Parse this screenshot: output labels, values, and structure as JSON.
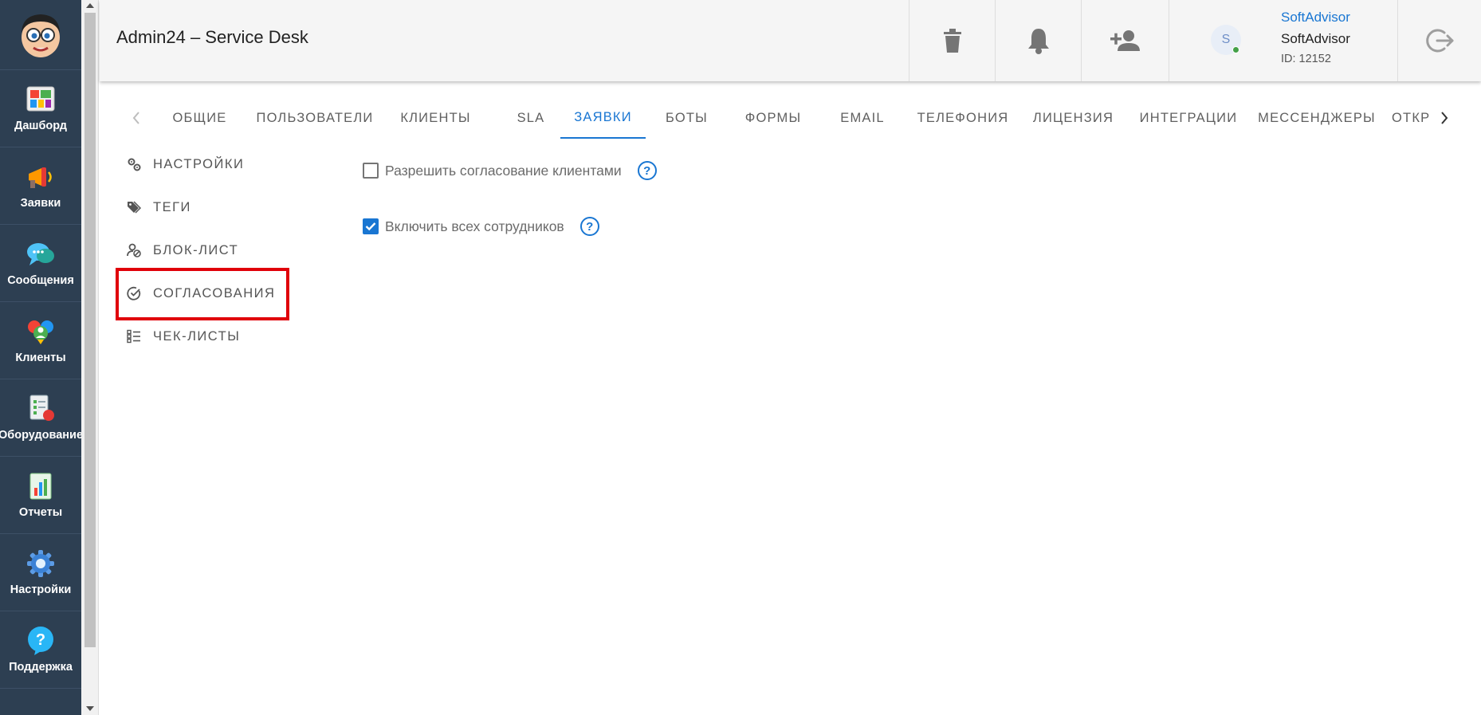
{
  "sidebar": {
    "items": [
      {
        "label": "Дашборд",
        "icon": "dashboard-icon"
      },
      {
        "label": "Заявки",
        "icon": "megaphone-icon"
      },
      {
        "label": "Сообщения",
        "icon": "chat-bubbles-icon"
      },
      {
        "label": "Клиенты",
        "icon": "clients-icon"
      },
      {
        "label": "Оборудование",
        "icon": "equipment-icon"
      },
      {
        "label": "Отчеты",
        "icon": "reports-icon"
      },
      {
        "label": "Настройки",
        "icon": "gear-icon"
      },
      {
        "label": "Поддержка",
        "icon": "support-icon"
      }
    ]
  },
  "header": {
    "title": "Admin24 – Service Desk",
    "user": {
      "avatar_letter": "S",
      "link_name": "SoftAdvisor",
      "name": "SoftAdvisor",
      "id_text": "ID: 12152"
    }
  },
  "tabs": {
    "items": [
      "ОБЩИЕ",
      "ПОЛЬЗОВАТЕЛИ",
      "КЛИЕНТЫ",
      "SLA",
      "ЗАЯВКИ",
      "БОТЫ",
      "ФОРМЫ",
      "EMAIL",
      "ТЕЛЕФОНИЯ",
      "ЛИЦЕНЗИЯ",
      "ИНТЕГРАЦИИ",
      "МЕССЕНДЖЕРЫ",
      "ОТКР"
    ],
    "active": "ЗАЯВКИ"
  },
  "side_menu": {
    "items": [
      {
        "label": "НАСТРОЙКИ",
        "icon": "settings-cog-icon"
      },
      {
        "label": "ТЕГИ",
        "icon": "tags-icon"
      },
      {
        "label": "БЛОК-ЛИСТ",
        "icon": "block-list-icon"
      },
      {
        "label": "СОГЛАСОВАНИЯ",
        "icon": "check-circle-icon"
      },
      {
        "label": "ЧЕК-ЛИСТЫ",
        "icon": "checklist-icon"
      }
    ],
    "active": "СОГЛАСОВАНИЯ"
  },
  "settings": [
    {
      "label": "Разрешить согласование клиентами",
      "checked": false
    },
    {
      "label": "Включить всех сотрудников",
      "checked": true
    }
  ],
  "colors": {
    "sidebar": "#2d3f52",
    "accent": "#1976d2",
    "highlight": "#e0000a"
  }
}
